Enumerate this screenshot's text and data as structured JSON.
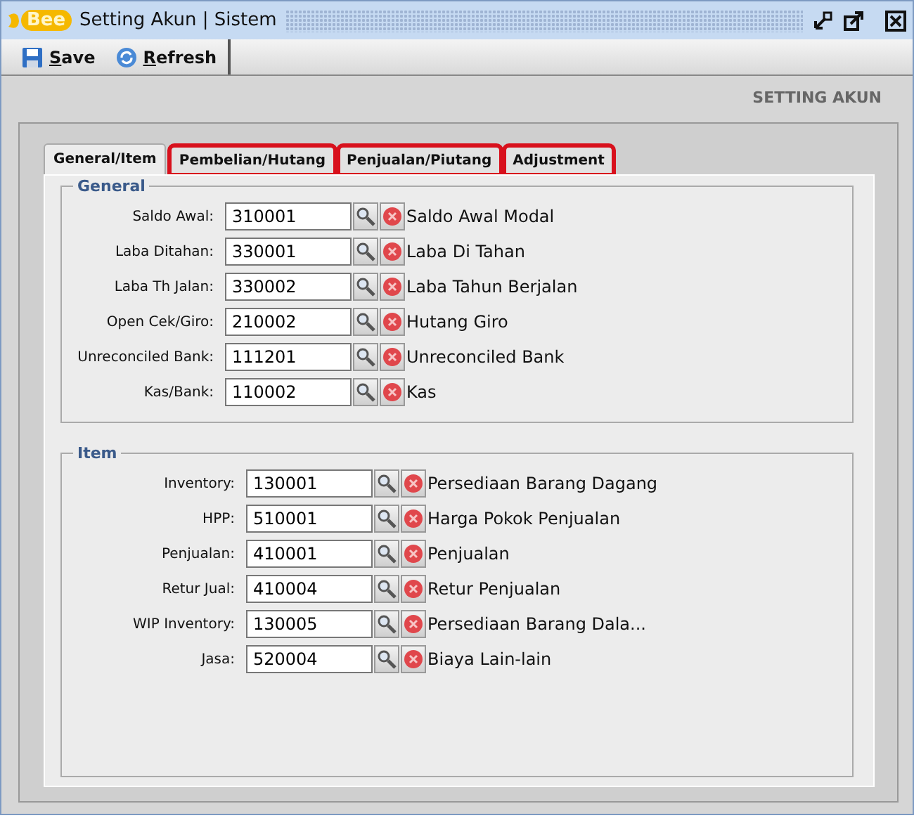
{
  "window": {
    "logo": "Bee",
    "title": "Setting Akun | Sistem"
  },
  "toolbar": [
    {
      "kind": "save",
      "label": "Save",
      "mnemonic": true
    },
    {
      "kind": "refresh",
      "label": "Refresh",
      "mnemonic": true
    }
  ],
  "page_heading": "SETTING AKUN",
  "tabs": [
    {
      "label": "General/Item",
      "selected": true,
      "highlighted": false
    },
    {
      "label": "Pembelian/Hutang",
      "selected": false,
      "highlighted": true
    },
    {
      "label": "Penjualan/Piutang",
      "selected": false,
      "highlighted": true
    },
    {
      "label": "Adjustment",
      "selected": false,
      "highlighted": true
    }
  ],
  "groups": [
    {
      "title": "General",
      "rows": [
        {
          "label": "Saldo Awal:",
          "code": "310001",
          "name": "Saldo Awal Modal"
        },
        {
          "label": "Laba Ditahan:",
          "code": "330001",
          "name": "Laba Di Tahan"
        },
        {
          "label": "Laba Th Jalan:",
          "code": "330002",
          "name": "Laba Tahun Berjalan"
        },
        {
          "label": "Open Cek/Giro:",
          "code": "210002",
          "name": "Hutang Giro"
        },
        {
          "label": "Unreconciled Bank:",
          "code": "111201",
          "name": "Unreconciled Bank"
        },
        {
          "label": "Kas/Bank:",
          "code": "110002",
          "name": "Kas"
        }
      ]
    },
    {
      "title": "Item",
      "rows": [
        {
          "label": "Inventory:",
          "code": "130001",
          "name": "Persediaan Barang Dagang"
        },
        {
          "label": "HPP:",
          "code": "510001",
          "name": "Harga Pokok Penjualan"
        },
        {
          "label": "Penjualan:",
          "code": "410001",
          "name": "Penjualan"
        },
        {
          "label": "Retur Jual:",
          "code": "410004",
          "name": "Retur Penjualan"
        },
        {
          "label": "WIP Inventory:",
          "code": "130005",
          "name": "Persediaan Barang Dala..."
        },
        {
          "label": "Jasa:",
          "code": "520004",
          "name": "Biaya Lain-lain"
        }
      ]
    }
  ]
}
